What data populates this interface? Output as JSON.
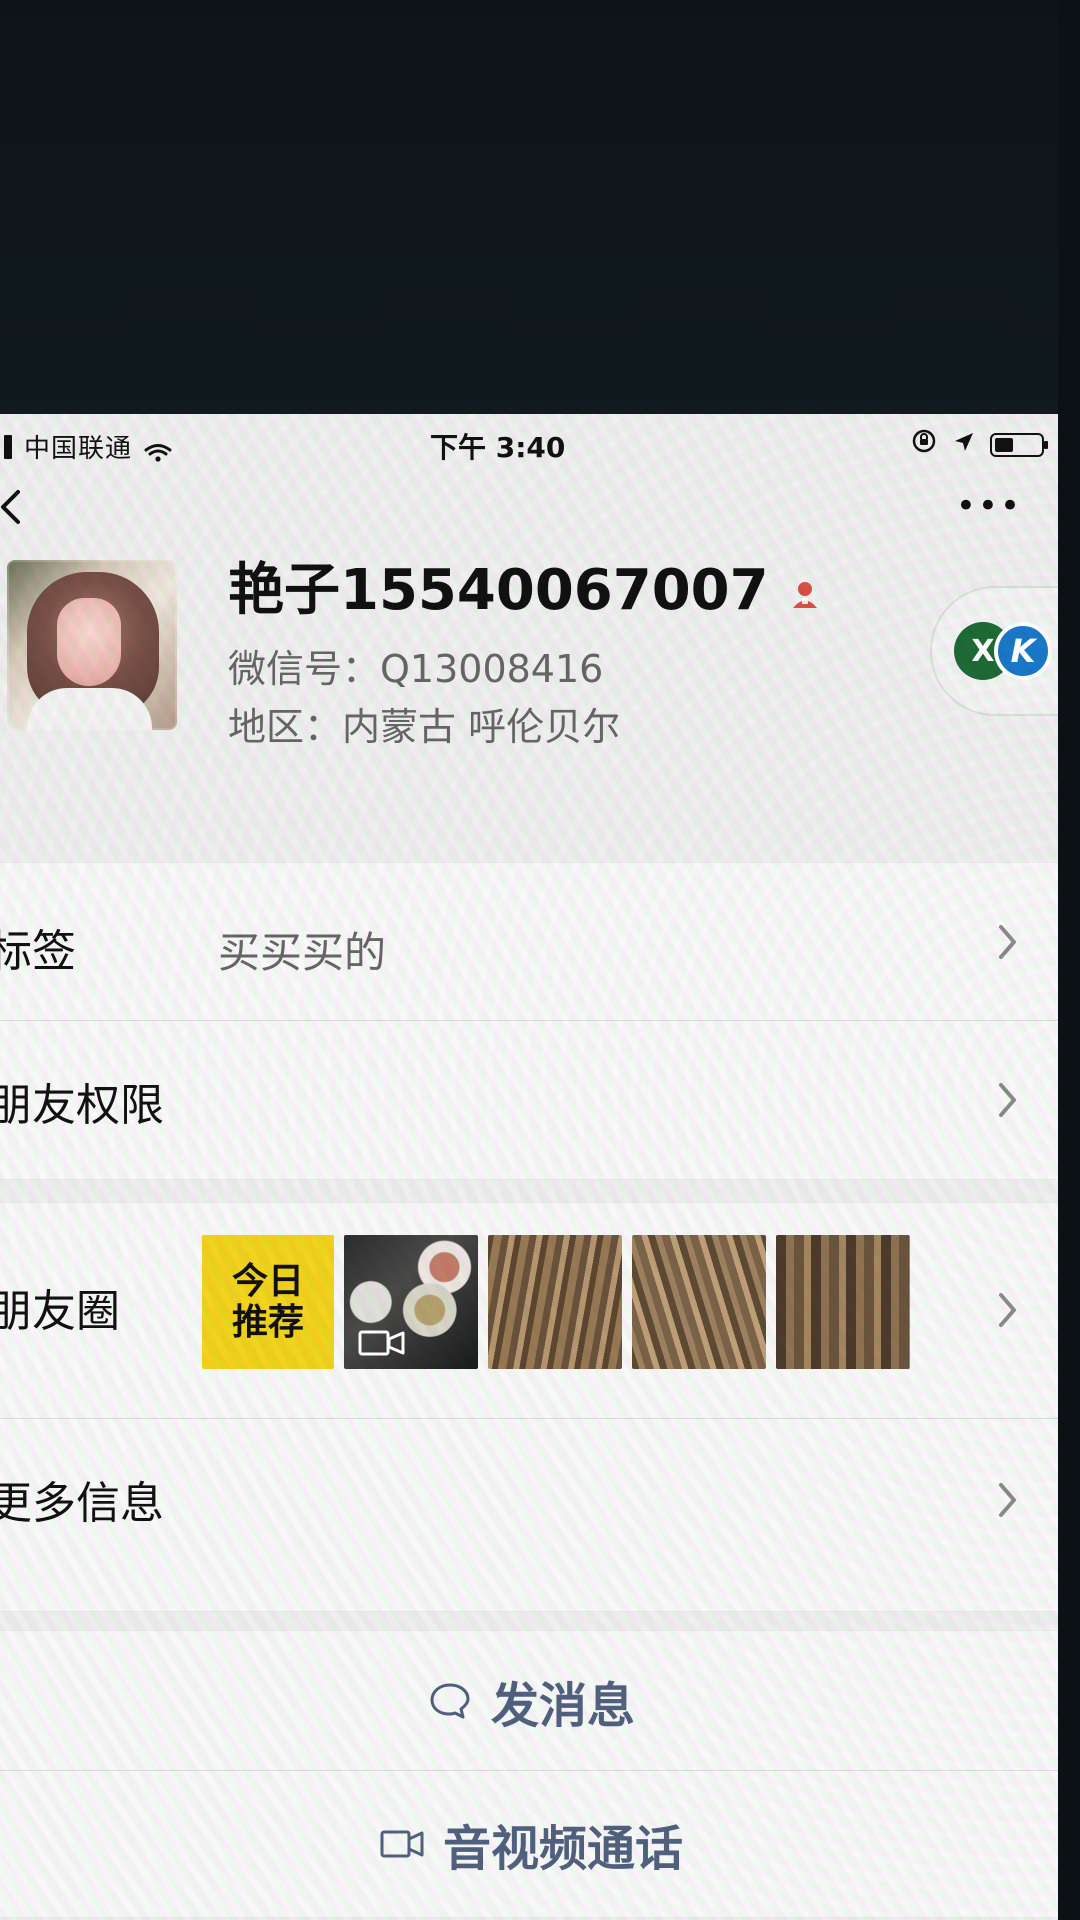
{
  "status_bar": {
    "carrier": "中国联通",
    "time": "下午 3:40"
  },
  "profile": {
    "name": "艳子15540067007",
    "wechat_id": "微信号：Q13008416",
    "region": "地区：内蒙古 呼伦贝尔",
    "badges": {
      "x": "X",
      "k": "K"
    }
  },
  "rows": {
    "tags_label": "标签",
    "tags_value": "买买买的",
    "friend_permissions_label": "朋友权限",
    "moments_label": "朋友圈",
    "more_info_label": "更多信息",
    "today_recommend": "今日\n推荐"
  },
  "actions": {
    "send_message": "发消息",
    "av_call": "音视频通话"
  },
  "colors": {
    "accent_blue": "#51617f",
    "badge_green": "#1e6a36",
    "badge_blue": "#1a78c8"
  }
}
